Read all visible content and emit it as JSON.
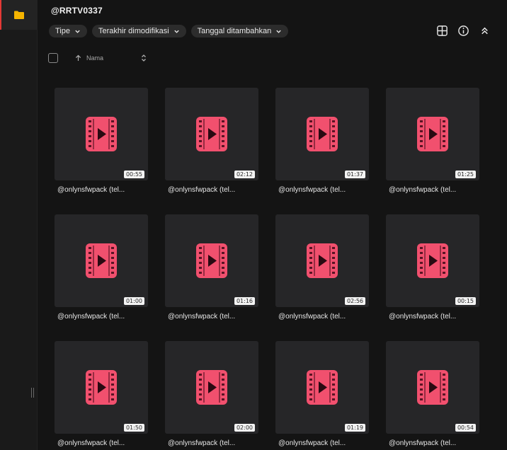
{
  "header": {
    "title": "@RRTV0337"
  },
  "sidebar": {
    "items": [
      {
        "icon": "folder-icon",
        "color": "#f5b400"
      }
    ]
  },
  "filters": [
    {
      "label": "Tipe"
    },
    {
      "label": "Terakhir dimodifikasi"
    },
    {
      "label": "Tanggal ditambahkan"
    }
  ],
  "actions": [
    {
      "icon": "grid-view-icon"
    },
    {
      "icon": "info-icon"
    },
    {
      "icon": "collapse-icon"
    }
  ],
  "sort": {
    "column_label": "Nama",
    "direction": "ascending"
  },
  "colors": {
    "accent": "#e53935",
    "video_icon": "#f1506e",
    "folder": "#f5b400"
  },
  "items": [
    {
      "name": "@onlynsfwpack (tel...",
      "duration": "00:55"
    },
    {
      "name": "@onlynsfwpack (tel...",
      "duration": "02:12"
    },
    {
      "name": "@onlynsfwpack (tel...",
      "duration": "01:37"
    },
    {
      "name": "@onlynsfwpack (tel...",
      "duration": "01:25"
    },
    {
      "name": "@onlynsfwpack (tel...",
      "duration": "01:00"
    },
    {
      "name": "@onlynsfwpack (tel...",
      "duration": "01:16"
    },
    {
      "name": "@onlynsfwpack (tel...",
      "duration": "02:56"
    },
    {
      "name": "@onlynsfwpack (tel...",
      "duration": "00:15"
    },
    {
      "name": "@onlynsfwpack (tel...",
      "duration": "01:50"
    },
    {
      "name": "@onlynsfwpack (tel...",
      "duration": "02:00"
    },
    {
      "name": "@onlynsfwpack (tel...",
      "duration": "01:19"
    },
    {
      "name": "@onlynsfwpack (tel...",
      "duration": "00:54"
    }
  ]
}
